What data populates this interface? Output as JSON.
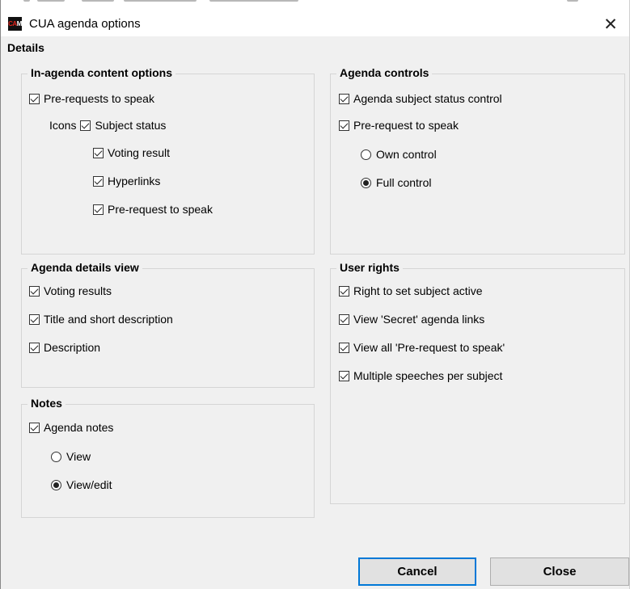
{
  "window": {
    "title": "CUA agenda options",
    "app_icon_text": [
      "CA",
      "M"
    ],
    "close_symbol": "✕",
    "icon": "app-logo-icon"
  },
  "details_heading": "Details",
  "content_options": {
    "title": "In-agenda content options",
    "pre_requests": {
      "label": "Pre-requests to speak",
      "checked": true
    },
    "icons_label": "Icons",
    "icons": [
      {
        "label": "Subject status",
        "checked": true
      },
      {
        "label": "Voting result",
        "checked": true
      },
      {
        "label": "Hyperlinks",
        "checked": true
      },
      {
        "label": "Pre-request to speak",
        "checked": true
      }
    ]
  },
  "agenda_controls": {
    "title": "Agenda controls",
    "subject_status": {
      "label": "Agenda subject status control",
      "checked": true
    },
    "pre_request": {
      "label": "Pre-request to speak",
      "checked": true
    },
    "options": [
      {
        "label": "Own control",
        "selected": false
      },
      {
        "label": "Full control",
        "selected": true
      }
    ]
  },
  "details_view": {
    "title": "Agenda details view",
    "items": [
      {
        "label": "Voting results",
        "checked": true
      },
      {
        "label": "Title and short description",
        "checked": true
      },
      {
        "label": "Description",
        "checked": true
      }
    ]
  },
  "user_rights": {
    "title": "User rights",
    "items": [
      {
        "label": "Right to set subject active",
        "checked": true
      },
      {
        "label": "View 'Secret' agenda links",
        "checked": true
      },
      {
        "label": "View all 'Pre-request to speak'",
        "checked": true
      },
      {
        "label": "Multiple speeches per subject",
        "checked": true
      }
    ]
  },
  "notes": {
    "title": "Notes",
    "agenda_notes": {
      "label": "Agenda notes",
      "checked": true
    },
    "options": [
      {
        "label": "View",
        "selected": false
      },
      {
        "label": "View/edit",
        "selected": true
      }
    ]
  },
  "buttons": {
    "cancel": "Cancel",
    "close": "Close"
  },
  "colors": {
    "dialog_bg": "#f0f0f0",
    "titlebar_bg": "#ffffff",
    "button_bg": "#e1e1e1",
    "focus_border": "#0078d7",
    "group_border": "#d5d5d5"
  }
}
